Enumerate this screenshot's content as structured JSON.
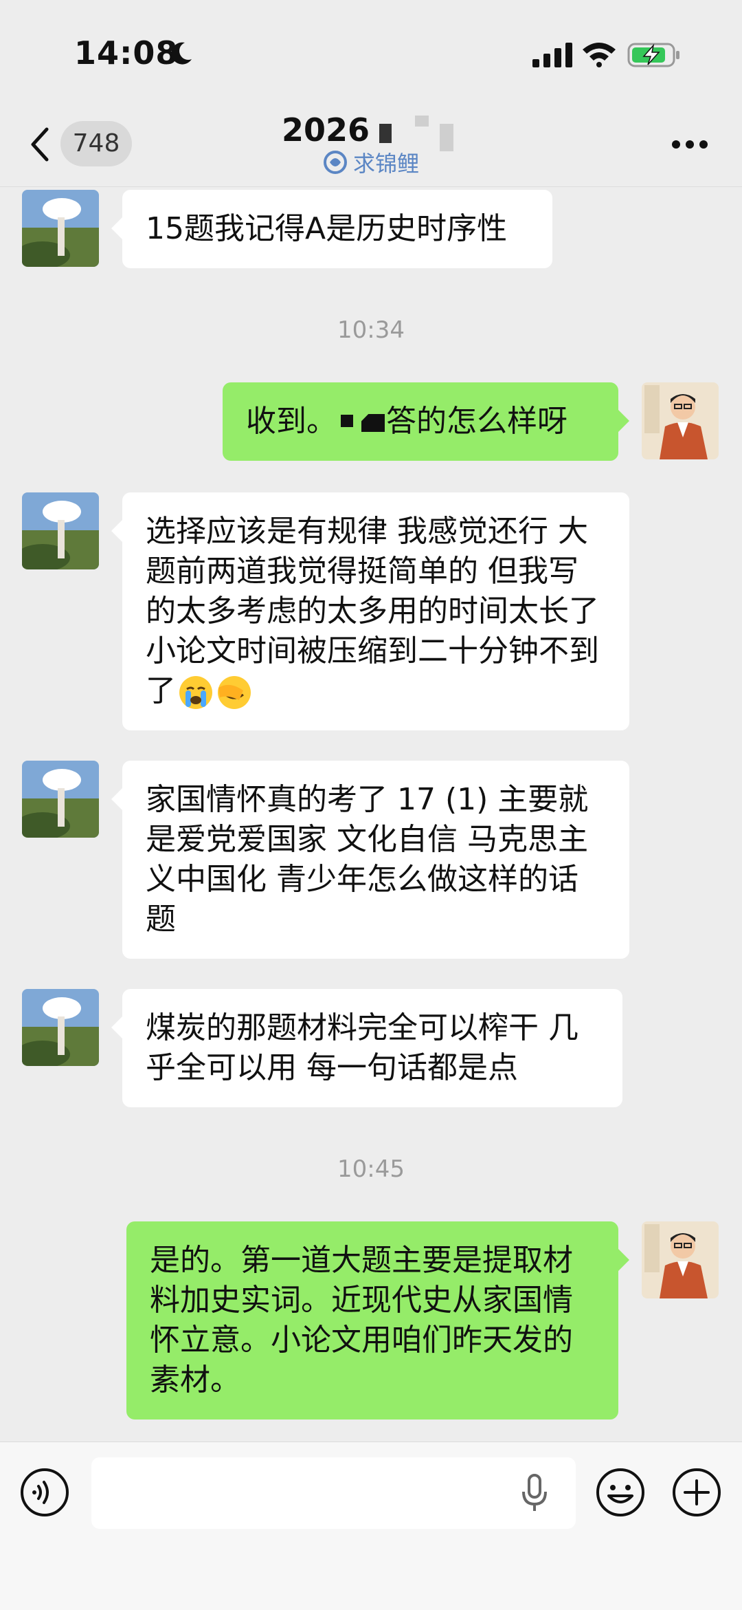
{
  "status_bar": {
    "time": "14:08"
  },
  "header": {
    "back_count": "748",
    "title": "2026",
    "subtitle": "求锦鲤"
  },
  "messages": [
    {
      "side": "in",
      "text": "15题我记得A是历史时序性"
    },
    {
      "timestamp": "10:34"
    },
    {
      "side": "out",
      "text_pre": "收到。",
      "text_post": "答的怎么样呀"
    },
    {
      "side": "in",
      "text": "选择应该是有规律 我感觉还行 大题前两道我觉得挺简单的 但我写的太多考虑的太多用的时间太长了 小论文时间被压缩到二十分钟不到了"
    },
    {
      "side": "in",
      "text": "家国情怀真的考了 17 (1) 主要就是爱党爱国家 文化自信 马克思主义中国化 青少年怎么做这样的话题"
    },
    {
      "side": "in",
      "text": "煤炭的那题材料完全可以榨干 几乎全可以用 每一句话都是点"
    },
    {
      "timestamp": "10:45"
    },
    {
      "side": "out",
      "text": "是的。第一道大题主要是提取材料加史实词。近现代史从家国情怀立意。小论文用咱们昨天发的素材。"
    }
  ],
  "colors": {
    "incoming_bubble": "#ffffff",
    "outgoing_bubble": "#95ec69",
    "background": "#ededed",
    "timestamp": "#9a9a9a"
  },
  "input_bar": {
    "placeholder": ""
  }
}
